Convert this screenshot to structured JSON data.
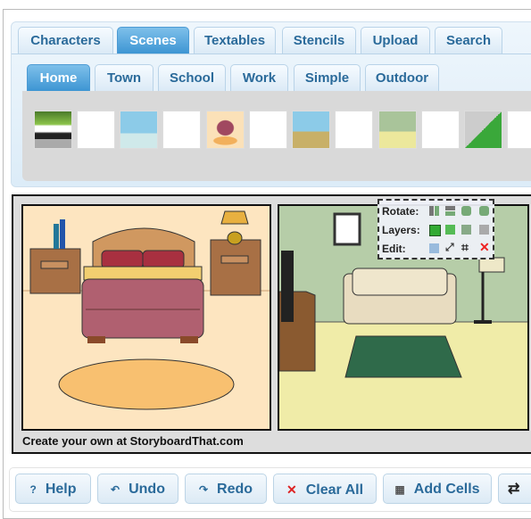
{
  "main_tabs": [
    {
      "label": "Characters"
    },
    {
      "label": "Scenes",
      "active": true
    },
    {
      "label": "Textables"
    },
    {
      "label": "Stencils"
    },
    {
      "label": "Upload"
    },
    {
      "label": "Search"
    }
  ],
  "sub_tabs": [
    {
      "label": "Home",
      "active": true
    },
    {
      "label": "Town"
    },
    {
      "label": "School"
    },
    {
      "label": "Work"
    },
    {
      "label": "Simple"
    },
    {
      "label": "Outdoor"
    }
  ],
  "thumbnails": [
    "street-fence",
    "street-outline",
    "bathroom",
    "bathroom-outline",
    "bedroom",
    "bedroom-outline",
    "living-room-blue",
    "living-room-outline",
    "living-room-green",
    "living-room-green-outline",
    "yard",
    "yard-outline"
  ],
  "canvas": {
    "caption": "Create your own at StoryboardThat.com"
  },
  "controls": {
    "rotate_label": "Rotate:",
    "layers_label": "Layers:",
    "edit_label": "Edit:"
  },
  "toolbar": [
    {
      "label": "Help",
      "icon": "help-icon",
      "glyph": "?"
    },
    {
      "label": "Undo",
      "icon": "undo-icon",
      "glyph": "↶"
    },
    {
      "label": "Redo",
      "icon": "redo-icon",
      "glyph": "↷"
    },
    {
      "label": "Clear All",
      "icon": "clear-icon",
      "glyph": "✕"
    },
    {
      "label": "Add Cells",
      "icon": "grid-icon",
      "glyph": "▦"
    },
    {
      "label": "",
      "icon": "swap-icon",
      "glyph": "⇄"
    }
  ],
  "colors": {
    "accent": "#3d95d3",
    "tab_text": "#2a6a9a"
  }
}
